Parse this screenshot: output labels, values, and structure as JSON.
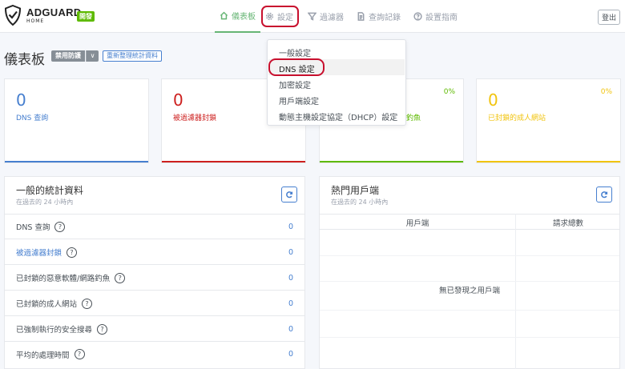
{
  "header": {
    "logo_main": "ADGUARD",
    "logo_sub": "HOME",
    "badge": "開發",
    "logout": "登出",
    "nav": [
      {
        "label": "儀表板",
        "icon": "home-icon",
        "active": true
      },
      {
        "label": "設定",
        "icon": "gear-icon",
        "active": false
      },
      {
        "label": "過濾器",
        "icon": "filter-icon",
        "active": false
      },
      {
        "label": "查詢記錄",
        "icon": "document-icon",
        "active": false
      },
      {
        "label": "設置指南",
        "icon": "help-circle-icon",
        "active": false
      }
    ]
  },
  "settings_menu": {
    "items": [
      "一般設定",
      "DNS 設定",
      "加密設定",
      "用戶端設定",
      "動態主機設定協定（DHCP）設定"
    ]
  },
  "page": {
    "title": "儀表板",
    "disable_protection": "禁用防護",
    "refresh_stats": "重新整理統計資料"
  },
  "stat_cards": [
    {
      "value": "0",
      "label": "DNS 查詢",
      "percent": "",
      "color": "#467fcf"
    },
    {
      "value": "0",
      "label": "被過濾器封鎖",
      "percent": "",
      "color": "#cd201f"
    },
    {
      "value": "",
      "label": "釣魚",
      "percent": "0%",
      "color": "#5eba00"
    },
    {
      "value": "0",
      "label": "已封鎖的成人網站",
      "percent": "0%",
      "color": "#f1c40f"
    }
  ],
  "general_stats": {
    "title": "一般的統計資料",
    "subtitle": "在過去的 24 小時內",
    "rows": [
      {
        "label": "DNS 查詢",
        "value": "0"
      },
      {
        "label": "被過濾器封鎖",
        "value": "0"
      },
      {
        "label": "已封鎖的惡意軟體/網路釣魚",
        "value": "0"
      },
      {
        "label": "已封鎖的成人網站",
        "value": "0"
      },
      {
        "label": "已強制執行的安全搜尋",
        "value": "0"
      },
      {
        "label": "平均的處理時間",
        "value": "0"
      }
    ]
  },
  "top_clients": {
    "title": "熱門用戶端",
    "subtitle": "在過去的 24 小時內",
    "col_client": "用戶端",
    "col_requests": "請求總數",
    "empty": "無已發現之用戶端"
  }
}
